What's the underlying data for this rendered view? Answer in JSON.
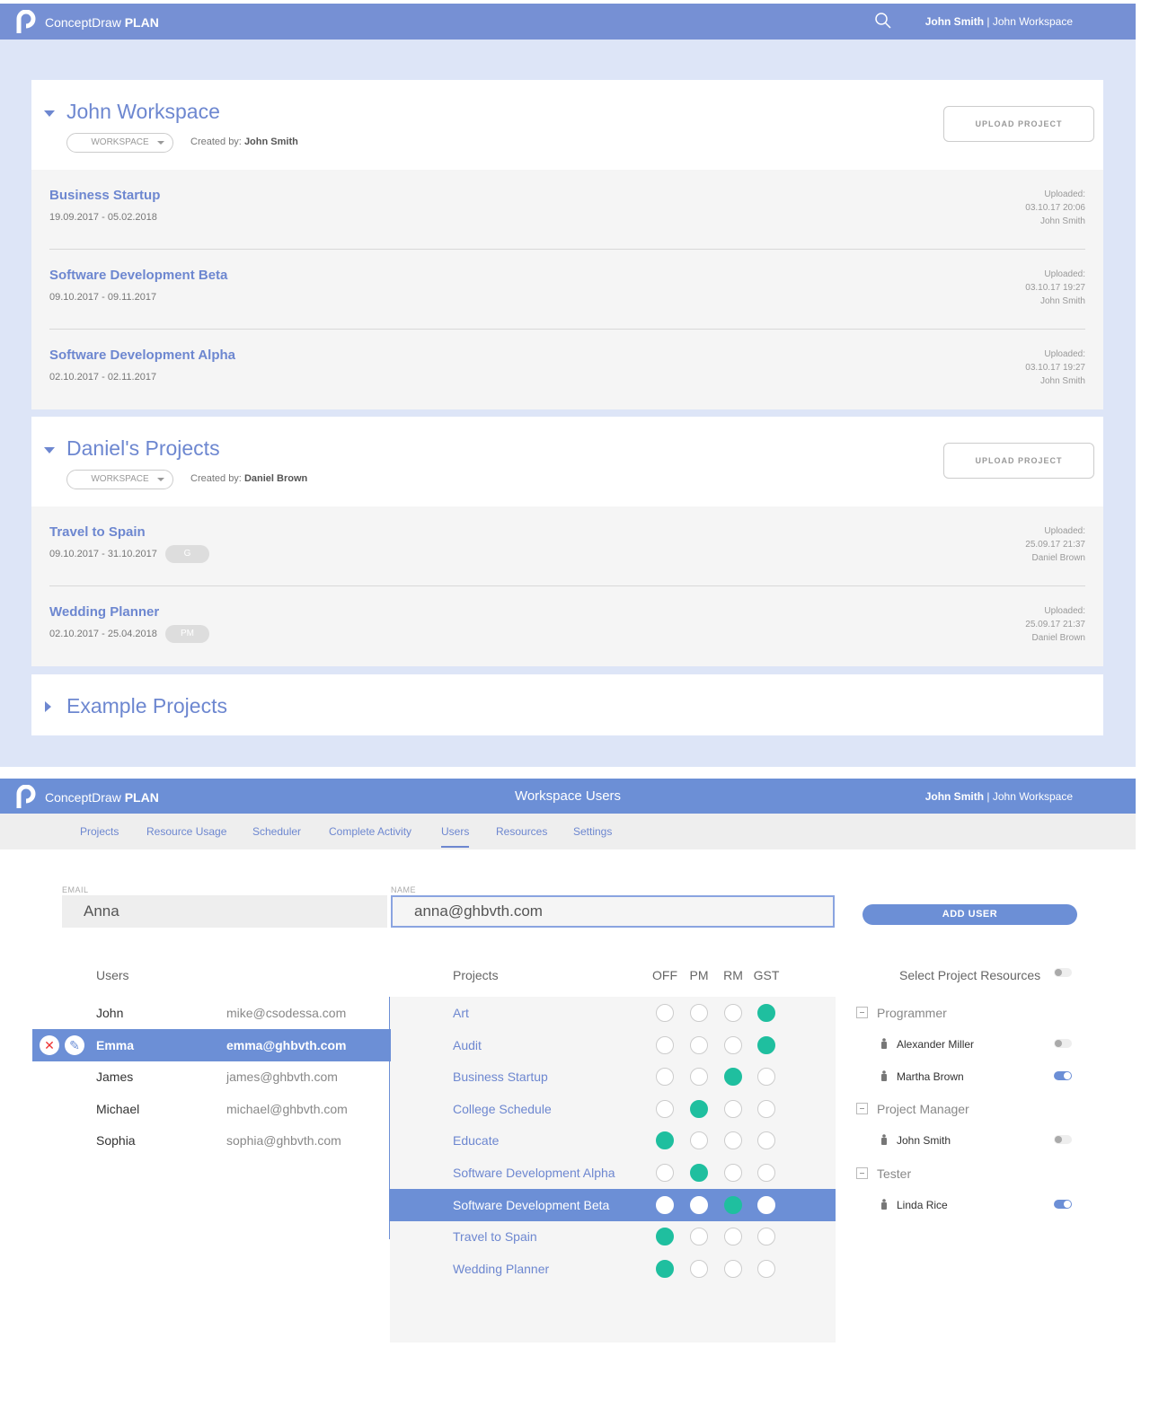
{
  "app": {
    "brand_light": "ConceptDraw",
    "brand_bold": "PLAN",
    "user": "John Smith",
    "workspace": "John Workspace",
    "sep": "|"
  },
  "workspaces": [
    {
      "title": "John Workspace",
      "dropdown": "WORKSPACE",
      "created_label": "Created by:",
      "created_by": "John Smith",
      "upload": "UPLOAD PROJECT",
      "projects": [
        {
          "name": "Business Startup",
          "dates": "19.09.2017 - 05.02.2018",
          "uploaded": "Uploaded:",
          "time": "03.10.17 20:06",
          "by": "John Smith"
        },
        {
          "name": "Software Development Beta",
          "dates": "09.10.2017 - 09.11.2017",
          "uploaded": "Uploaded:",
          "time": "03.10.17 19:27",
          "by": "John Smith"
        },
        {
          "name": "Software Development Alpha",
          "dates": "02.10.2017 - 02.11.2017",
          "uploaded": "Uploaded:",
          "time": "03.10.17 19:27",
          "by": "John Smith"
        }
      ]
    },
    {
      "title": "Daniel's Projects",
      "dropdown": "WORKSPACE",
      "created_label": "Created by:",
      "created_by": "Daniel Brown",
      "upload": "UPLOAD PROJECT",
      "projects": [
        {
          "name": "Travel to Spain",
          "dates": "09.10.2017 - 31.10.2017",
          "tag": "G",
          "uploaded": "Uploaded:",
          "time": "25.09.17 21:37",
          "by": "Daniel Brown"
        },
        {
          "name": "Wedding Planner",
          "dates": "02.10.2017 - 25.04.2018",
          "tag": "PM",
          "uploaded": "Uploaded:",
          "time": "25.09.17 21:37",
          "by": "Daniel Brown"
        }
      ]
    },
    {
      "title": "Example Projects"
    }
  ],
  "users_page": {
    "title": "Workspace Users",
    "nav": [
      "Projects",
      "Resource Usage",
      "Scheduler",
      "Complete Activity",
      "Users",
      "Resources",
      "Settings"
    ],
    "active_nav": "Users",
    "email_label": "EMAIL",
    "email_value": "Anna",
    "name_label": "NAME",
    "name_value": "anna@ghbvth.com",
    "add_user": "ADD USER",
    "users_header": "Users",
    "users": [
      {
        "name": "John",
        "email": "mike@csodessa.com"
      },
      {
        "name": "Emma",
        "email": "emma@ghbvth.com",
        "selected": true
      },
      {
        "name": "James",
        "email": "james@ghbvth.com"
      },
      {
        "name": "Michael",
        "email": "michael@ghbvth.com"
      },
      {
        "name": "Sophia",
        "email": "sophia@ghbvth.com"
      }
    ],
    "projects_header": "Projects",
    "role_cols": [
      "OFF",
      "PM",
      "RM",
      "GST"
    ],
    "projects": [
      {
        "name": "Art",
        "role": 3
      },
      {
        "name": "Audit",
        "role": 3
      },
      {
        "name": "Business Startup",
        "role": 2
      },
      {
        "name": "College Schedule",
        "role": 1
      },
      {
        "name": "Educate",
        "role": 0
      },
      {
        "name": "Software Development Alpha",
        "role": 1
      },
      {
        "name": "Software Development Beta",
        "role": 2,
        "selected": true
      },
      {
        "name": "Travel to Spain",
        "role": 0
      },
      {
        "name": "Wedding Planner",
        "role": 0
      }
    ],
    "resources_header": "Select Project Resources",
    "resources_toggle": false,
    "resource_groups": [
      {
        "name": "Programmer",
        "people": [
          {
            "name": "Alexander Miller",
            "on": false
          },
          {
            "name": "Martha Brown",
            "on": true
          }
        ]
      },
      {
        "name": "Project Manager",
        "people": [
          {
            "name": "John Smith",
            "on": false
          }
        ]
      },
      {
        "name": "Tester",
        "people": [
          {
            "name": "Linda Rice",
            "on": true
          }
        ]
      }
    ]
  },
  "colors": {
    "accent": "#6c8fd6",
    "teal": "#1fbf9f",
    "bg": "#dde5f7"
  }
}
